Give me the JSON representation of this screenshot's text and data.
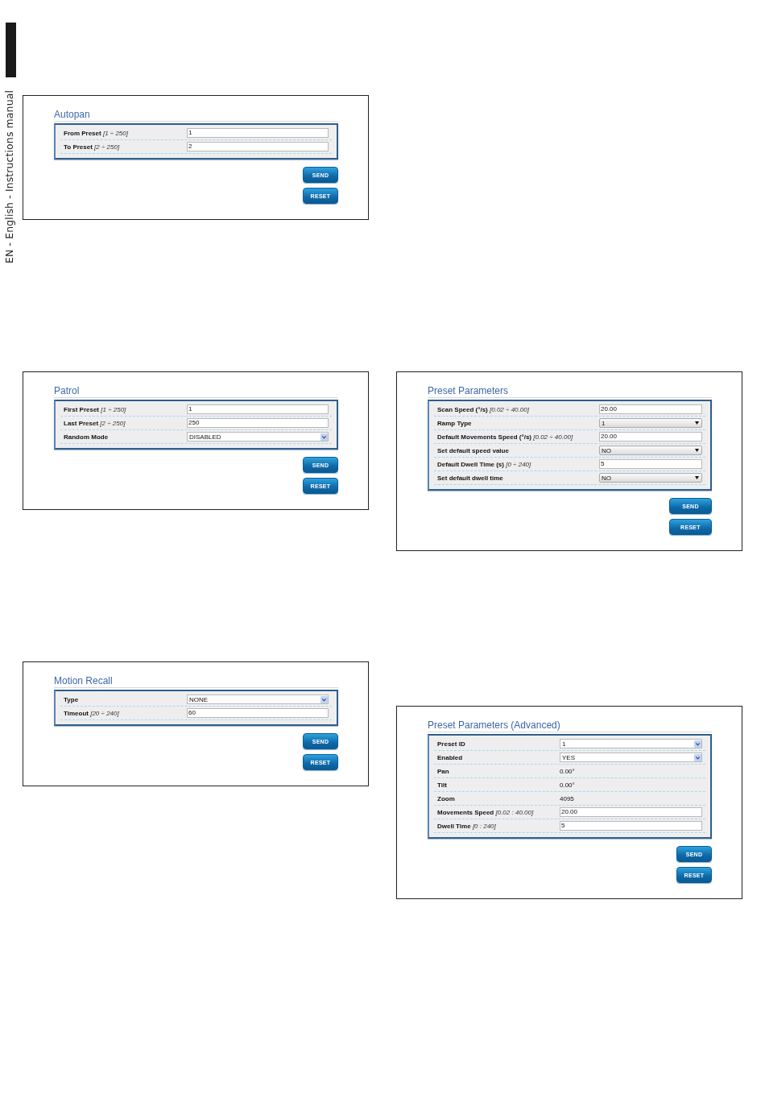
{
  "side_tab": {
    "text": "EN - English - Instructions manual"
  },
  "left_column": {
    "panels": [
      {
        "title": "Autopan",
        "fields": [
          {
            "kind": "input",
            "label": "From Preset *[1 ÷ 250]*",
            "value": "1"
          },
          {
            "kind": "input",
            "label": "To Preset *[2 ÷ 250]*",
            "value": "2"
          }
        ],
        "buttons": [
          "SEND",
          "RESET"
        ]
      },
      {
        "title": "Patrol",
        "fields": [
          {
            "kind": "input",
            "label": "First Preset *[1 ÷ 250]*",
            "value": "1"
          },
          {
            "kind": "input",
            "label": "Last Preset *[2 ÷ 250]*",
            "value": "250"
          },
          {
            "kind": "select",
            "label": "Random Mode",
            "value": "DISABLED"
          }
        ],
        "buttons": [
          "SEND",
          "RESET"
        ]
      },
      {
        "title": "Motion Recall",
        "fields": [
          {
            "kind": "select",
            "label": "Type",
            "value": "NONE"
          },
          {
            "kind": "input",
            "label": "Timeout *[20 ÷ 240]*",
            "value": "60"
          }
        ],
        "buttons": [
          "SEND",
          "RESET"
        ]
      }
    ]
  },
  "right_column": {
    "panels": [
      {
        "title": "Preset Parameters",
        "fields": [
          {
            "kind": "input",
            "label": "Scan Speed (°/s) *[0.02 ÷ 40.00]*",
            "value": "20.00"
          },
          {
            "kind": "dropdown",
            "label": "Ramp Type",
            "value": "1"
          },
          {
            "kind": "input",
            "label": "Default Movements Speed (°/s) *[0.02 ÷ 40.00]*",
            "value": "20.00"
          },
          {
            "kind": "dropdown",
            "label": "Set default speed value",
            "value": "NO"
          },
          {
            "kind": "input",
            "label": "Default Dwell Time (s) *[0 ÷ 240]*",
            "value": "5"
          },
          {
            "kind": "dropdown",
            "label": "Set default dwell time",
            "value": "NO"
          }
        ],
        "buttons": [
          "SEND",
          "RESET"
        ]
      },
      {
        "title": "Preset Parameters (Advanced)",
        "fields": [
          {
            "kind": "select",
            "label": "Preset ID",
            "value": "1"
          },
          {
            "kind": "select",
            "label": "Enabled",
            "value": "YES"
          },
          {
            "kind": "readout",
            "label": "Pan",
            "value": "0.00°"
          },
          {
            "kind": "readout",
            "label": "Tilt",
            "value": "0.00°"
          },
          {
            "kind": "readout",
            "label": "Zoom",
            "value": "4095"
          },
          {
            "kind": "input",
            "label": "Movements Speed *[0.02 : 40.00]*",
            "value": "20.00"
          },
          {
            "kind": "input",
            "label": "Dwell Time *[0 : 240]*",
            "value": "5"
          }
        ],
        "buttons": [
          "SEND",
          "RESET"
        ]
      }
    ]
  }
}
